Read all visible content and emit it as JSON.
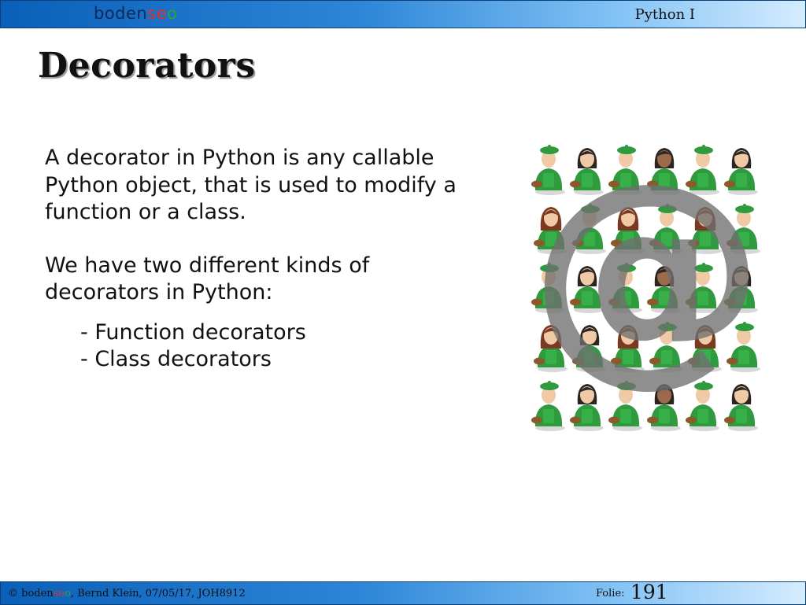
{
  "header": {
    "logo": {
      "part1": "boden",
      "part2": "se",
      "part3": "o"
    },
    "course": "Python I"
  },
  "slide": {
    "title": "Decorators",
    "paragraphs": [
      "A decorator in Python is any callable Python object, that is used to modify a function or a class.",
      "We have two different kinds of decorators in Python:"
    ],
    "list": [
      "- Function decorators",
      "- Class decorators"
    ]
  },
  "illustration": {
    "symbol": "@",
    "icon": "painter-figure-icon",
    "rows": 5,
    "cols": 6,
    "colors": {
      "apron": "#2f9a3e",
      "hair_dark": "#2b2522",
      "hair_brown": "#7a3a22",
      "skin": "#f0c9a6",
      "skin_dark": "#9a6a4a",
      "at_sign": "#707070"
    }
  },
  "footer": {
    "copyright_prefix": "©",
    "logo": {
      "part1": "boden",
      "part2": "se",
      "part3": "o"
    },
    "credit": ", Bernd Klein, 07/05/17, JOH8912",
    "folie_label": "Folie:",
    "page_number": "191"
  }
}
